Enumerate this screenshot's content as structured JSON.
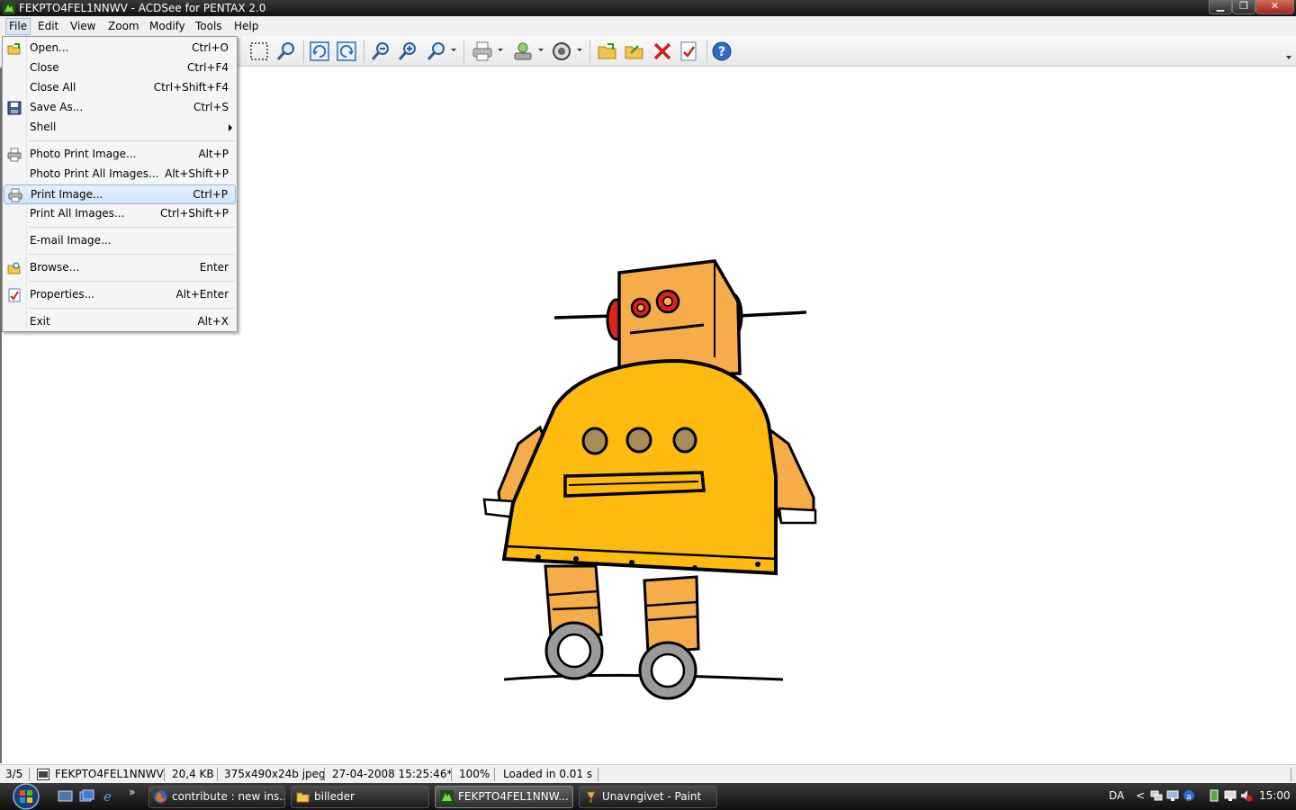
{
  "window": {
    "title": "FEKPTO4FEL1NNWV - ACDSee for PENTAX 2.0",
    "minimize_glyph": "▁",
    "maximize_glyph": "❐",
    "close_glyph": "✕"
  },
  "menubar": {
    "items": [
      {
        "label": "File"
      },
      {
        "label": "Edit"
      },
      {
        "label": "View"
      },
      {
        "label": "Zoom"
      },
      {
        "label": "Modify"
      },
      {
        "label": "Tools"
      },
      {
        "label": "Help"
      }
    ]
  },
  "toolbar": {
    "icons": [
      "select-icon",
      "zoom-tool-icon",
      "rotate-left-icon",
      "rotate-right-icon",
      "zoom-out-icon",
      "zoom-in-icon",
      "zoom-menu-icon",
      "print-icon",
      "scanner-icon",
      "slideshow-icon",
      "open-folder-icon",
      "copy-to-folder-icon",
      "delete-icon",
      "properties-icon",
      "help-icon"
    ]
  },
  "file_menu": {
    "items": [
      {
        "label": "Open...",
        "shortcut": "Ctrl+O",
        "icon": "open-icon"
      },
      {
        "label": "Close",
        "shortcut": "Ctrl+F4"
      },
      {
        "label": "Close All",
        "shortcut": "Ctrl+Shift+F4"
      },
      {
        "label": "Save As...",
        "shortcut": "Ctrl+S",
        "icon": "save-icon"
      },
      {
        "label": "Shell",
        "shortcut": "",
        "submenu": true
      },
      {
        "label": "Photo Print Image...",
        "shortcut": "Alt+P",
        "icon": "photo-print-icon"
      },
      {
        "label": "Photo Print All Images...",
        "shortcut": "Alt+Shift+P"
      },
      {
        "label": "Print Image...",
        "shortcut": "Ctrl+P",
        "icon": "print-icon",
        "highlighted": true
      },
      {
        "label": "Print All Images...",
        "shortcut": "Ctrl+Shift+P"
      },
      {
        "label": "E-mail Image...",
        "shortcut": ""
      },
      {
        "label": "Browse...",
        "shortcut": "Enter",
        "icon": "browse-icon"
      },
      {
        "label": "Properties...",
        "shortcut": "Alt+Enter",
        "icon": "properties-icon"
      },
      {
        "label": "Exit",
        "shortcut": "Alt+X"
      }
    ]
  },
  "statusbar": {
    "index": "3/5",
    "filename": "FEKPTO4FEL1NNWV",
    "filesize": "20,4 KB",
    "dimensions": "375x490x24b jpeg",
    "modified": "27-04-2008 15:25:46*",
    "zoom": "100%",
    "load_time": "Loaded in 0.01 s"
  },
  "taskbar": {
    "quicklaunch_more": "»",
    "tasks": [
      {
        "label": "contribute : new ins...",
        "icon": "firefox-icon"
      },
      {
        "label": "billeder",
        "icon": "folder-icon"
      },
      {
        "label": "FEKPTO4FEL1NNW...",
        "icon": "acdsee-icon",
        "active": true
      },
      {
        "label": "Unavngivet - Paint",
        "icon": "paint-icon"
      }
    ],
    "language": "DA",
    "tray_expand": "<",
    "clock": "15:00"
  },
  "colors": {
    "robot_body": "#fdbb10",
    "robot_head": "#f4ad48",
    "robot_eyes": "#d9231b",
    "wheels": "#9a9a9a",
    "menu_highlight": "#cfe4fa"
  }
}
